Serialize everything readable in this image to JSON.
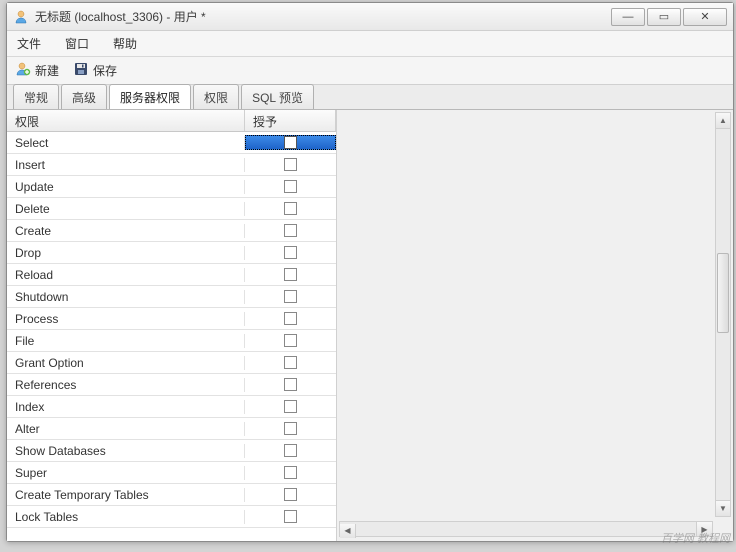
{
  "window": {
    "title": "无标题 (localhost_3306) - 用户 *"
  },
  "menu": {
    "file": "文件",
    "window": "窗口",
    "help": "帮助"
  },
  "toolbar": {
    "new_label": "新建",
    "save_label": "保存"
  },
  "tabs": {
    "general": "常规",
    "advanced": "高级",
    "server_priv": "服务器权限",
    "priv": "权限",
    "sql_preview": "SQL 预览"
  },
  "grid": {
    "header_priv": "权限",
    "header_grant": "授予",
    "rows": [
      {
        "name": "Select",
        "checked": false,
        "selected": true
      },
      {
        "name": "Insert",
        "checked": false,
        "selected": false
      },
      {
        "name": "Update",
        "checked": false,
        "selected": false
      },
      {
        "name": "Delete",
        "checked": false,
        "selected": false
      },
      {
        "name": "Create",
        "checked": false,
        "selected": false
      },
      {
        "name": "Drop",
        "checked": false,
        "selected": false
      },
      {
        "name": "Reload",
        "checked": false,
        "selected": false
      },
      {
        "name": "Shutdown",
        "checked": false,
        "selected": false
      },
      {
        "name": "Process",
        "checked": false,
        "selected": false
      },
      {
        "name": "File",
        "checked": false,
        "selected": false
      },
      {
        "name": "Grant Option",
        "checked": false,
        "selected": false
      },
      {
        "name": "References",
        "checked": false,
        "selected": false
      },
      {
        "name": "Index",
        "checked": false,
        "selected": false
      },
      {
        "name": "Alter",
        "checked": false,
        "selected": false
      },
      {
        "name": "Show Databases",
        "checked": false,
        "selected": false
      },
      {
        "name": "Super",
        "checked": false,
        "selected": false
      },
      {
        "name": "Create Temporary Tables",
        "checked": false,
        "selected": false
      },
      {
        "name": "Lock Tables",
        "checked": false,
        "selected": false
      }
    ]
  },
  "watermark": "百学网 教程网"
}
